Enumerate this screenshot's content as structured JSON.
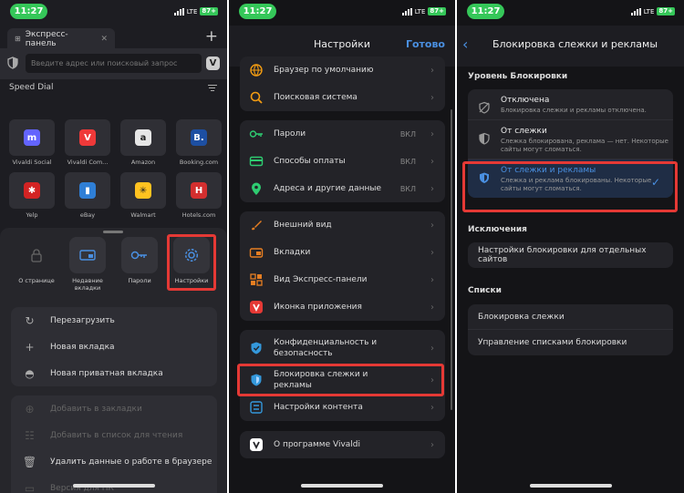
{
  "status": {
    "time": "11:27",
    "network": "LTE",
    "battery": "87+"
  },
  "screen1": {
    "tab_title": "Экспресс-панель",
    "address_placeholder": "Введите адрес или поисковый запрос",
    "speed_dial_label": "Speed Dial",
    "tiles": [
      {
        "label": "Vivaldi Social",
        "icon": "mastodon-icon",
        "color": "#6364ff",
        "glyph": "m"
      },
      {
        "label": "Vivaldi Com...",
        "icon": "vivaldi-icon",
        "color": "#ef3939",
        "glyph": "V"
      },
      {
        "label": "Amazon",
        "icon": "amazon-icon",
        "color": "#e6e6e6",
        "glyph": "a"
      },
      {
        "label": "Booking.com",
        "icon": "booking-icon",
        "color": "#1d4fa2",
        "glyph": "B."
      },
      {
        "label": "Yelp",
        "icon": "yelp-icon",
        "color": "#d32323",
        "glyph": "✱"
      },
      {
        "label": "eBay",
        "icon": "ebay-icon",
        "color": "#2f7fd6",
        "glyph": "▮"
      },
      {
        "label": "Walmart",
        "icon": "walmart-icon",
        "color": "#ffc220",
        "glyph": "✳"
      },
      {
        "label": "Hotels.com",
        "icon": "hotels-icon",
        "color": "#d32f2f",
        "glyph": "H"
      }
    ],
    "quick_actions": [
      {
        "label": "О странице",
        "icon": "lock-icon"
      },
      {
        "label": "Недавние вкладки",
        "icon": "recent-tabs-icon"
      },
      {
        "label": "Пароли",
        "icon": "key-icon"
      },
      {
        "label": "Настройки",
        "icon": "gear-icon"
      }
    ],
    "menu_top": [
      {
        "label": "Перезагрузить",
        "icon": "reload-icon"
      },
      {
        "label": "Новая вкладка",
        "icon": "plus-icon"
      },
      {
        "label": "Новая приватная вкладка",
        "icon": "ghost-icon"
      }
    ],
    "menu_bottom": [
      {
        "label": "Добавить в закладки",
        "icon": "bookmark-add-icon",
        "disabled": true
      },
      {
        "label": "Добавить в список для чтения",
        "icon": "reading-list-icon",
        "disabled": true
      },
      {
        "label": "Удалить данные о работе в браузере",
        "icon": "trash-icon",
        "disabled": false
      },
      {
        "label": "Версия для ПК",
        "icon": "desktop-icon",
        "disabled": true
      }
    ]
  },
  "screen2": {
    "title": "Настройки",
    "done": "Готово",
    "groups": [
      [
        {
          "label": "Браузер по умолчанию",
          "icon": "globe-icon",
          "color": "#f39c12"
        },
        {
          "label": "Поисковая система",
          "icon": "search-icon",
          "color": "#f39c12"
        }
      ],
      [
        {
          "label": "Пароли",
          "icon": "key-icon",
          "color": "#2ecc71",
          "value": "ВКЛ"
        },
        {
          "label": "Способы оплаты",
          "icon": "card-icon",
          "color": "#2ecc71",
          "value": "ВКЛ"
        },
        {
          "label": "Адреса и другие данные",
          "icon": "location-icon",
          "color": "#2ecc71",
          "value": "ВКЛ"
        }
      ],
      [
        {
          "label": "Внешний вид",
          "icon": "paint-icon",
          "color": "#e67e22"
        },
        {
          "label": "Вкладки",
          "icon": "tabs-icon",
          "color": "#e67e22"
        },
        {
          "label": "Вид Экспресс-панели",
          "icon": "grid-icon",
          "color": "#e67e22"
        },
        {
          "label": "Иконка приложения",
          "icon": "vivaldi-icon",
          "color": "#e53935"
        }
      ],
      [
        {
          "label": "Конфиденциальность и безопасность",
          "icon": "shield-check-icon",
          "color": "#3498db"
        },
        {
          "label": "Блокировка слежки и рекламы",
          "icon": "shield-icon",
          "color": "#3498db"
        },
        {
          "label": "Настройки контента",
          "icon": "content-settings-icon",
          "color": "#3498db"
        }
      ],
      [
        {
          "label": "О программе Vivaldi",
          "icon": "vivaldi-icon",
          "color": "#ffffff"
        }
      ]
    ]
  },
  "screen3": {
    "title": "Блокировка слежки и рекламы",
    "level_header": "Уровень Блокировки",
    "levels": [
      {
        "title": "Отключена",
        "desc": "Блокировка слежки и рекламы отключена.",
        "icon": "shield-off-icon",
        "selected": false
      },
      {
        "title": "От слежки",
        "desc": "Слежка блокирована, реклама — нет. Некоторые сайты могут сломаться.",
        "icon": "shield-half-icon",
        "selected": false
      },
      {
        "title": "От слежки и рекламы",
        "desc": "Слежка и реклама блокированы. Некоторые сайты могут сломаться.",
        "icon": "shield-full-icon",
        "selected": true
      }
    ],
    "exceptions_header": "Исключения",
    "exceptions_item": "Настройки блокировки для отдельных сайтов",
    "lists_header": "Списки",
    "lists_items": [
      "Блокировка слежки",
      "Управление списками блокировки"
    ]
  }
}
